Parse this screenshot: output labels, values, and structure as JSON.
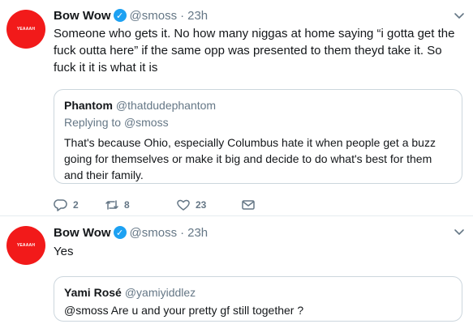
{
  "tweets": [
    {
      "avatar_text": [
        "",
        "YEAAAH"
      ],
      "name": "Bow Wow",
      "handle": "@smoss",
      "separator": "·",
      "time": "23h",
      "text": "Someone who gets it. No how many niggas at home saying “i gotta get the fuck outta here” if the same opp was presented to them theyd take it. So fuck it it is what it is",
      "quote": {
        "name": "Phantom",
        "handle": "@thatdudephantom",
        "replying_prefix": "Replying to",
        "replying_handle": "@smoss",
        "text": "That's because Ohio, especially Columbus hate it when people get a buzz going for themselves or make it big and decide to do what's best for them and their family."
      },
      "actions": {
        "replies": "2",
        "retweets": "8",
        "likes": "23"
      }
    },
    {
      "avatar_text": [
        "",
        "YEAAAH"
      ],
      "name": "Bow Wow",
      "handle": "@smoss",
      "separator": "·",
      "time": "23h",
      "text": "Yes",
      "quote": {
        "name": "Yami Rosé",
        "handle": "@yamiyiddlez",
        "text": "@smoss Are u and your pretty gf still together ?"
      }
    }
  ],
  "colors": {
    "avatar": "#f21a1a",
    "verified": "#1da1f2",
    "muted": "#657786",
    "border": "#ccd6dd"
  },
  "icons": [
    "verified-icon",
    "caret-down-icon",
    "reply-icon",
    "retweet-icon",
    "like-icon",
    "message-icon"
  ]
}
